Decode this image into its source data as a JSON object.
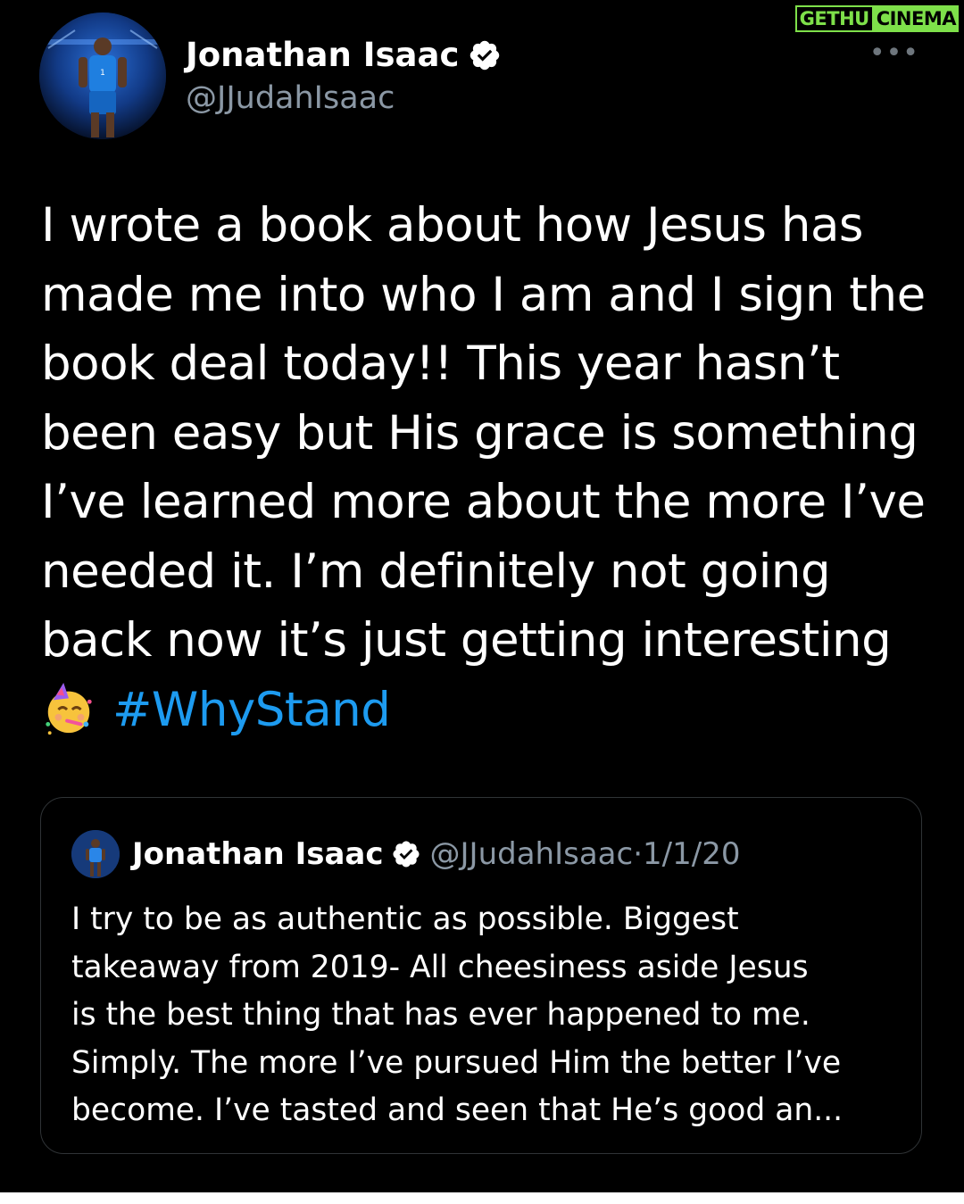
{
  "watermark": {
    "part1": "GETHU",
    "part2": "CINEMA"
  },
  "author": {
    "name": "Jonathan Isaac",
    "handle": "@JJudahIsaac",
    "verified": true,
    "avatar_icon": "player-avatar"
  },
  "menu_icon": "more-options-icon",
  "more_label": "•••",
  "tweet": {
    "lines": [
      "I wrote a book about how Jesus has",
      "made me into who I am and I sign the",
      "book deal today!! This year hasn’t",
      "been easy but His grace is something",
      "I’ve learned more about the more I’ve",
      "needed it. I’m definitely not going",
      "back now it’s just getting interesting"
    ],
    "emoji": "partying-face-emoji",
    "hashtag": "#WhyStand"
  },
  "quoted": {
    "name": "Jonathan Isaac",
    "handle": "@JJudahIsaac",
    "separator": " · ",
    "date": "1/1/20",
    "lines": [
      "I try to be as authentic as possible. Biggest",
      "takeaway from 2019- All cheesiness aside Jesus",
      "is the best thing that has ever happened to me.",
      "Simply. The more I’ve pursued Him the better I’ve",
      "become. I’ve tasted and seen that He’s good an..."
    ]
  },
  "colors": {
    "background": "#000000",
    "text": "#ffffff",
    "secondary": "#8b98a5",
    "link": "#1d9bf0",
    "border": "#2f3336",
    "watermark": "#7ee04a"
  }
}
